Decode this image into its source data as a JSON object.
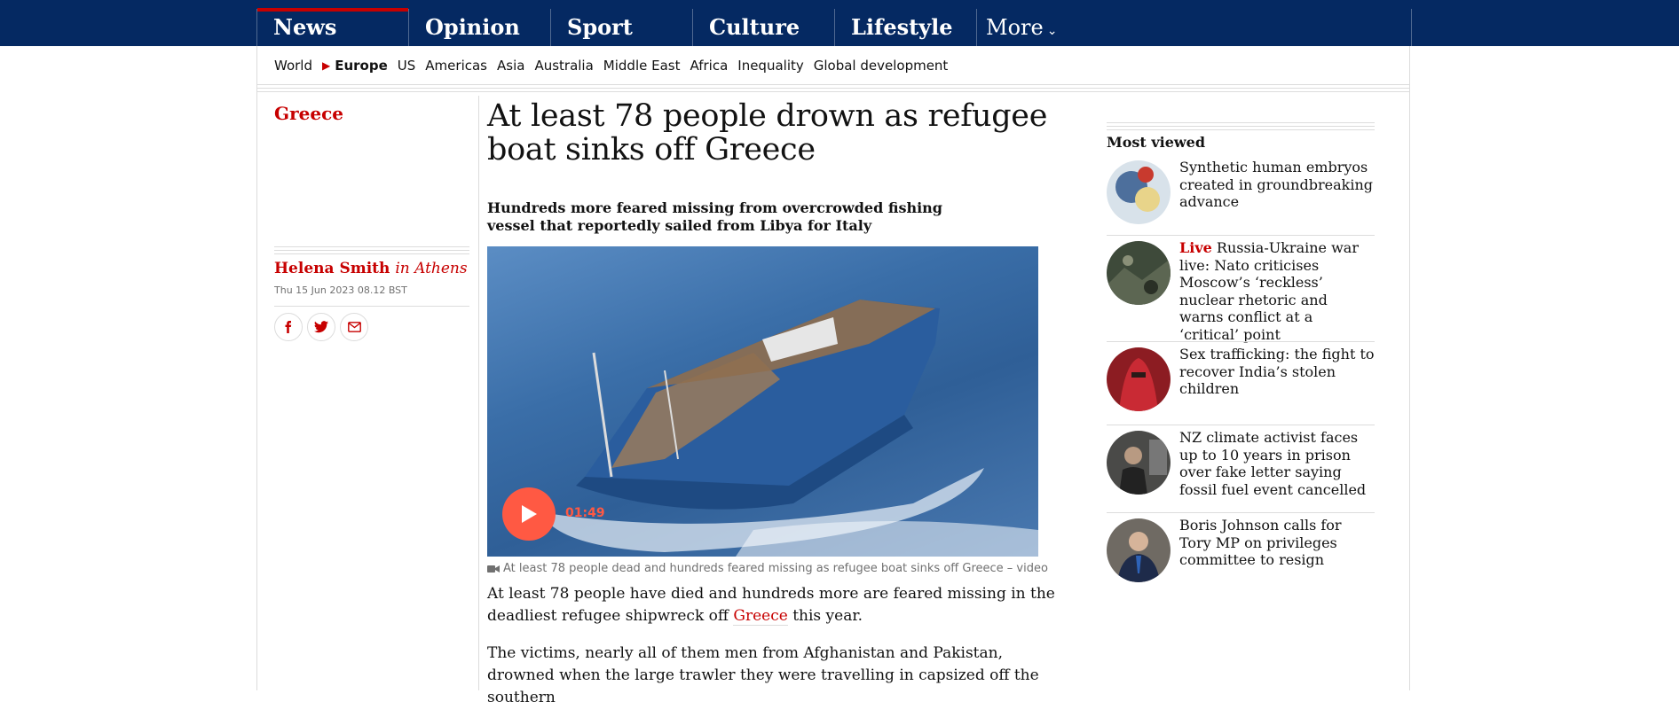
{
  "nav": {
    "pillars": [
      {
        "label": "News",
        "active": true
      },
      {
        "label": "Opinion",
        "active": false
      },
      {
        "label": "Sport",
        "active": false
      },
      {
        "label": "Culture",
        "active": false
      },
      {
        "label": "Lifestyle",
        "active": false
      }
    ],
    "more_label": "More",
    "sub": [
      "World",
      "Europe",
      "US",
      "Americas",
      "Asia",
      "Australia",
      "Middle East",
      "Africa",
      "Inequality",
      "Global development"
    ],
    "sub_active": "Europe"
  },
  "article": {
    "section": "Greece",
    "headline": "At least 78 people drown as refugee boat sinks off Greece",
    "standfirst": "Hundreds more feared missing from overcrowded fishing vessel that reportedly sailed from Libya for Italy",
    "author": "Helena Smith",
    "location": "in Athens",
    "date": "Thu 15 Jun 2023 08.12 BST",
    "share": [
      "facebook-icon",
      "twitter-icon",
      "email-icon"
    ],
    "video": {
      "duration": "01:49",
      "caption": "At least 78 people dead and hundreds feared missing as refugee boat sinks off Greece – video"
    },
    "paragraphs": [
      {
        "before": "At least 78 people have died and hundreds more are feared missing in the deadliest refugee shipwreck off ",
        "link": "Greece",
        "after": " this year."
      },
      {
        "text": "The victims, nearly all of them men from Afghanistan and Pakistan, drowned when the large trawler they were travelling in capsized off the southern"
      }
    ]
  },
  "most_viewed": {
    "title": "Most viewed",
    "items": [
      {
        "kicker": "",
        "text": "Synthetic human embryos created in groundbreaking advance"
      },
      {
        "kicker": "Live",
        "text": "Russia-Ukraine war live: Nato criticises Moscow’s ‘reckless’ nuclear rhetoric and warns conflict at a ‘critical’ point"
      },
      {
        "kicker": "",
        "text": "Sex trafficking: the fight to recover India’s stolen children"
      },
      {
        "kicker": "",
        "text": "NZ climate activist faces up to 10 years in prison over fake letter saying fossil fuel event cancelled"
      },
      {
        "kicker": "",
        "text": "Boris Johnson calls for Tory MP on privileges committee to resign"
      }
    ]
  },
  "colors": {
    "brand_blue": "#052962",
    "news_red": "#c70000",
    "play_orange": "#ff5943"
  }
}
